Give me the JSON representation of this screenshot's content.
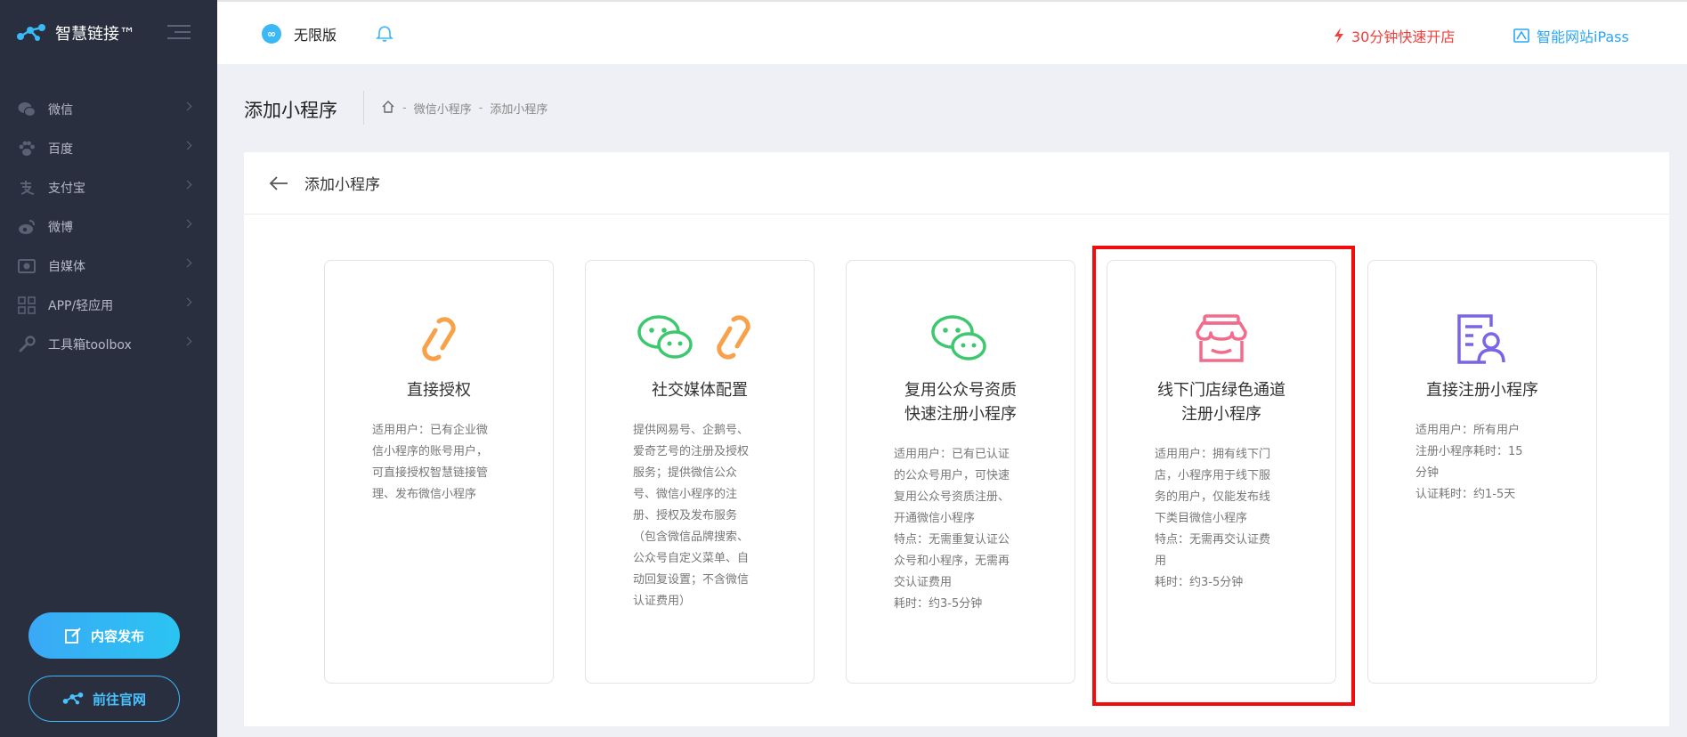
{
  "app": {
    "logo_text": "智慧链接™"
  },
  "sidebar": {
    "items": [
      {
        "label": "微信",
        "icon": "wechat-icon"
      },
      {
        "label": "百度",
        "icon": "paw-icon"
      },
      {
        "label": "支付宝",
        "icon": "alipay-icon"
      },
      {
        "label": "微博",
        "icon": "weibo-icon"
      },
      {
        "label": "自媒体",
        "icon": "media-icon"
      },
      {
        "label": "APP/轻应用",
        "icon": "app-grid-icon"
      },
      {
        "label": "工具箱toolbox",
        "icon": "wrench-icon"
      }
    ],
    "publish_button": "内容发布",
    "site_button": "前往官网"
  },
  "header": {
    "edition": "无限版",
    "quick_open": "30分钟快速开店",
    "ipass": "智能网站iPass"
  },
  "page": {
    "title": "添加小程序",
    "breadcrumb": [
      "微信小程序",
      "添加小程序"
    ],
    "panel_title": "添加小程序"
  },
  "cards": [
    {
      "title_lines": [
        "直接授权"
      ],
      "desc": [
        "适用用户：已有企业微",
        "信小程序的账号用户，",
        "可直接授权智慧链接管",
        "理、发布微信小程序"
      ],
      "icon": "link-icon"
    },
    {
      "title_lines": [
        "社交媒体配置"
      ],
      "desc": [
        "提供网易号、企鹅号、",
        "爱奇艺号的注册及授权",
        "服务；提供微信公众",
        "号、微信小程序的注",
        "册、授权及发布服务",
        "（包含微信品牌搜索、",
        "公众号自定义菜单、自",
        "动回复设置；不含微信",
        "认证费用）"
      ],
      "icon": "wechat-link-icon"
    },
    {
      "title_lines": [
        "复用公众号资质",
        "快速注册小程序"
      ],
      "desc": [
        "适用用户：已有已认证",
        "的公众号用户，可快速",
        "复用公众号资质注册、",
        "开通微信小程序",
        "特点：无需重复认证公",
        "众号和小程序，无需再",
        "交认证费用",
        "耗时：约3-5分钟"
      ],
      "icon": "wechat-icon"
    },
    {
      "title_lines": [
        "线下门店绿色通道",
        "注册小程序"
      ],
      "desc": [
        "适用用户：拥有线下门",
        "店，小程序用于线下服",
        "务的用户，仅能发布线",
        "下类目微信小程序",
        "特点：无需再交认证费",
        "用",
        "耗时：约3-5分钟"
      ],
      "icon": "store-icon"
    },
    {
      "title_lines": [
        "直接注册小程序"
      ],
      "desc": [
        "适用用户：所有用户",
        "注册小程序耗时：15",
        "分钟",
        "认证耗时：约1-5天"
      ],
      "icon": "id-card-icon"
    }
  ],
  "colors": {
    "sidebar_bg": "#2a2f40",
    "accent_blue": "#3ab9f6",
    "alert_red": "#f0403c",
    "highlight_red": "#f20d0d",
    "orange": "#f7a24a",
    "green": "#3dc86f",
    "pink": "#f36a8b",
    "purple": "#7a65e8"
  }
}
